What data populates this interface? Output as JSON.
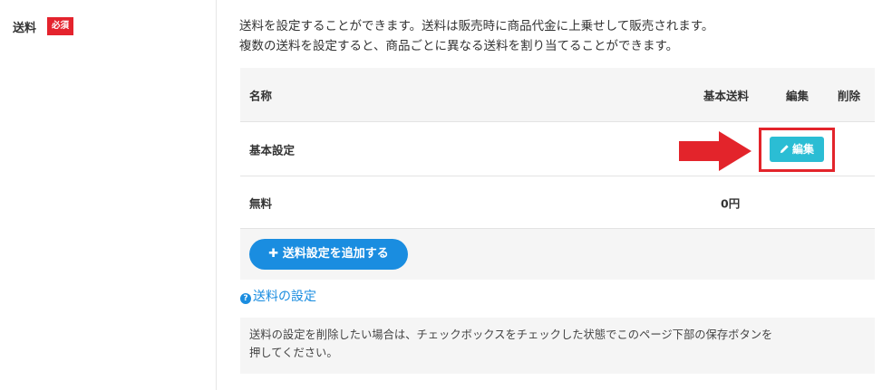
{
  "field": {
    "label": "送料",
    "required_badge": "必須"
  },
  "description": {
    "line1": "送料を設定することができます。送料は販売時に商品代金に上乗せして販売されます。",
    "line2": "複数の送料を設定すると、商品ごとに異なる送料を割り当てることができます。"
  },
  "table": {
    "headers": {
      "name": "名称",
      "base_fee": "基本送料",
      "edit": "編集",
      "delete": "削除"
    },
    "rows": [
      {
        "name": "基本設定",
        "base_fee": "",
        "edit_label": "編集"
      },
      {
        "name": "無料",
        "base_fee": "0円"
      }
    ]
  },
  "add_button": {
    "icon": "plus-icon",
    "label": "送料設定を追加する"
  },
  "help_link": {
    "icon": "question-circle-icon",
    "label": "送料の設定"
  },
  "note": {
    "line1": "送料の設定を削除したい場合は、チェックボックスをチェックした状態でこのページ下部の保存ボタンを",
    "line2": "押してください。"
  },
  "colors": {
    "required_badge": "#e4232d",
    "edit_button": "#2bbdd4",
    "add_button": "#1a8de0",
    "link": "#1a8de0",
    "annotation": "#e3242b"
  }
}
